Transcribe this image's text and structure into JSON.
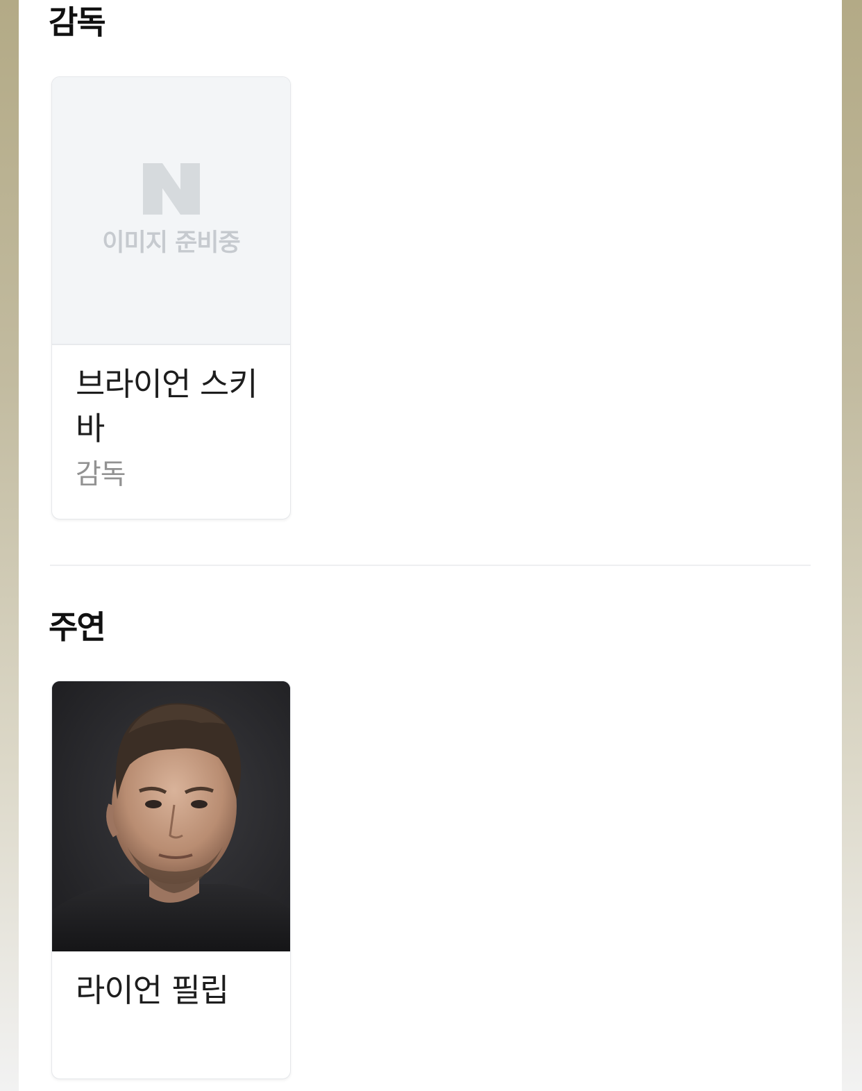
{
  "sections": [
    {
      "title": "감독",
      "people": [
        {
          "name": "브라이언 스키바",
          "role": "감독",
          "image": {
            "placeholder_text": "이미지 준비중",
            "logo_letter": "N"
          }
        }
      ]
    },
    {
      "title": "주연",
      "people": [
        {
          "name": "라이언 필립",
          "role": "",
          "image": {
            "type": "portrait photo"
          }
        }
      ]
    }
  ],
  "colors": {
    "page_background_top": "#b3aa86",
    "page_background_bottom": "#f2f2f2",
    "panel": "#ffffff",
    "placeholder_background": "#f3f5f7",
    "placeholder_logo": "#d6dadd",
    "placeholder_text": "#c6cacf",
    "name_text": "#1d1d1d",
    "role_text": "#929292",
    "title_text": "#111111"
  }
}
